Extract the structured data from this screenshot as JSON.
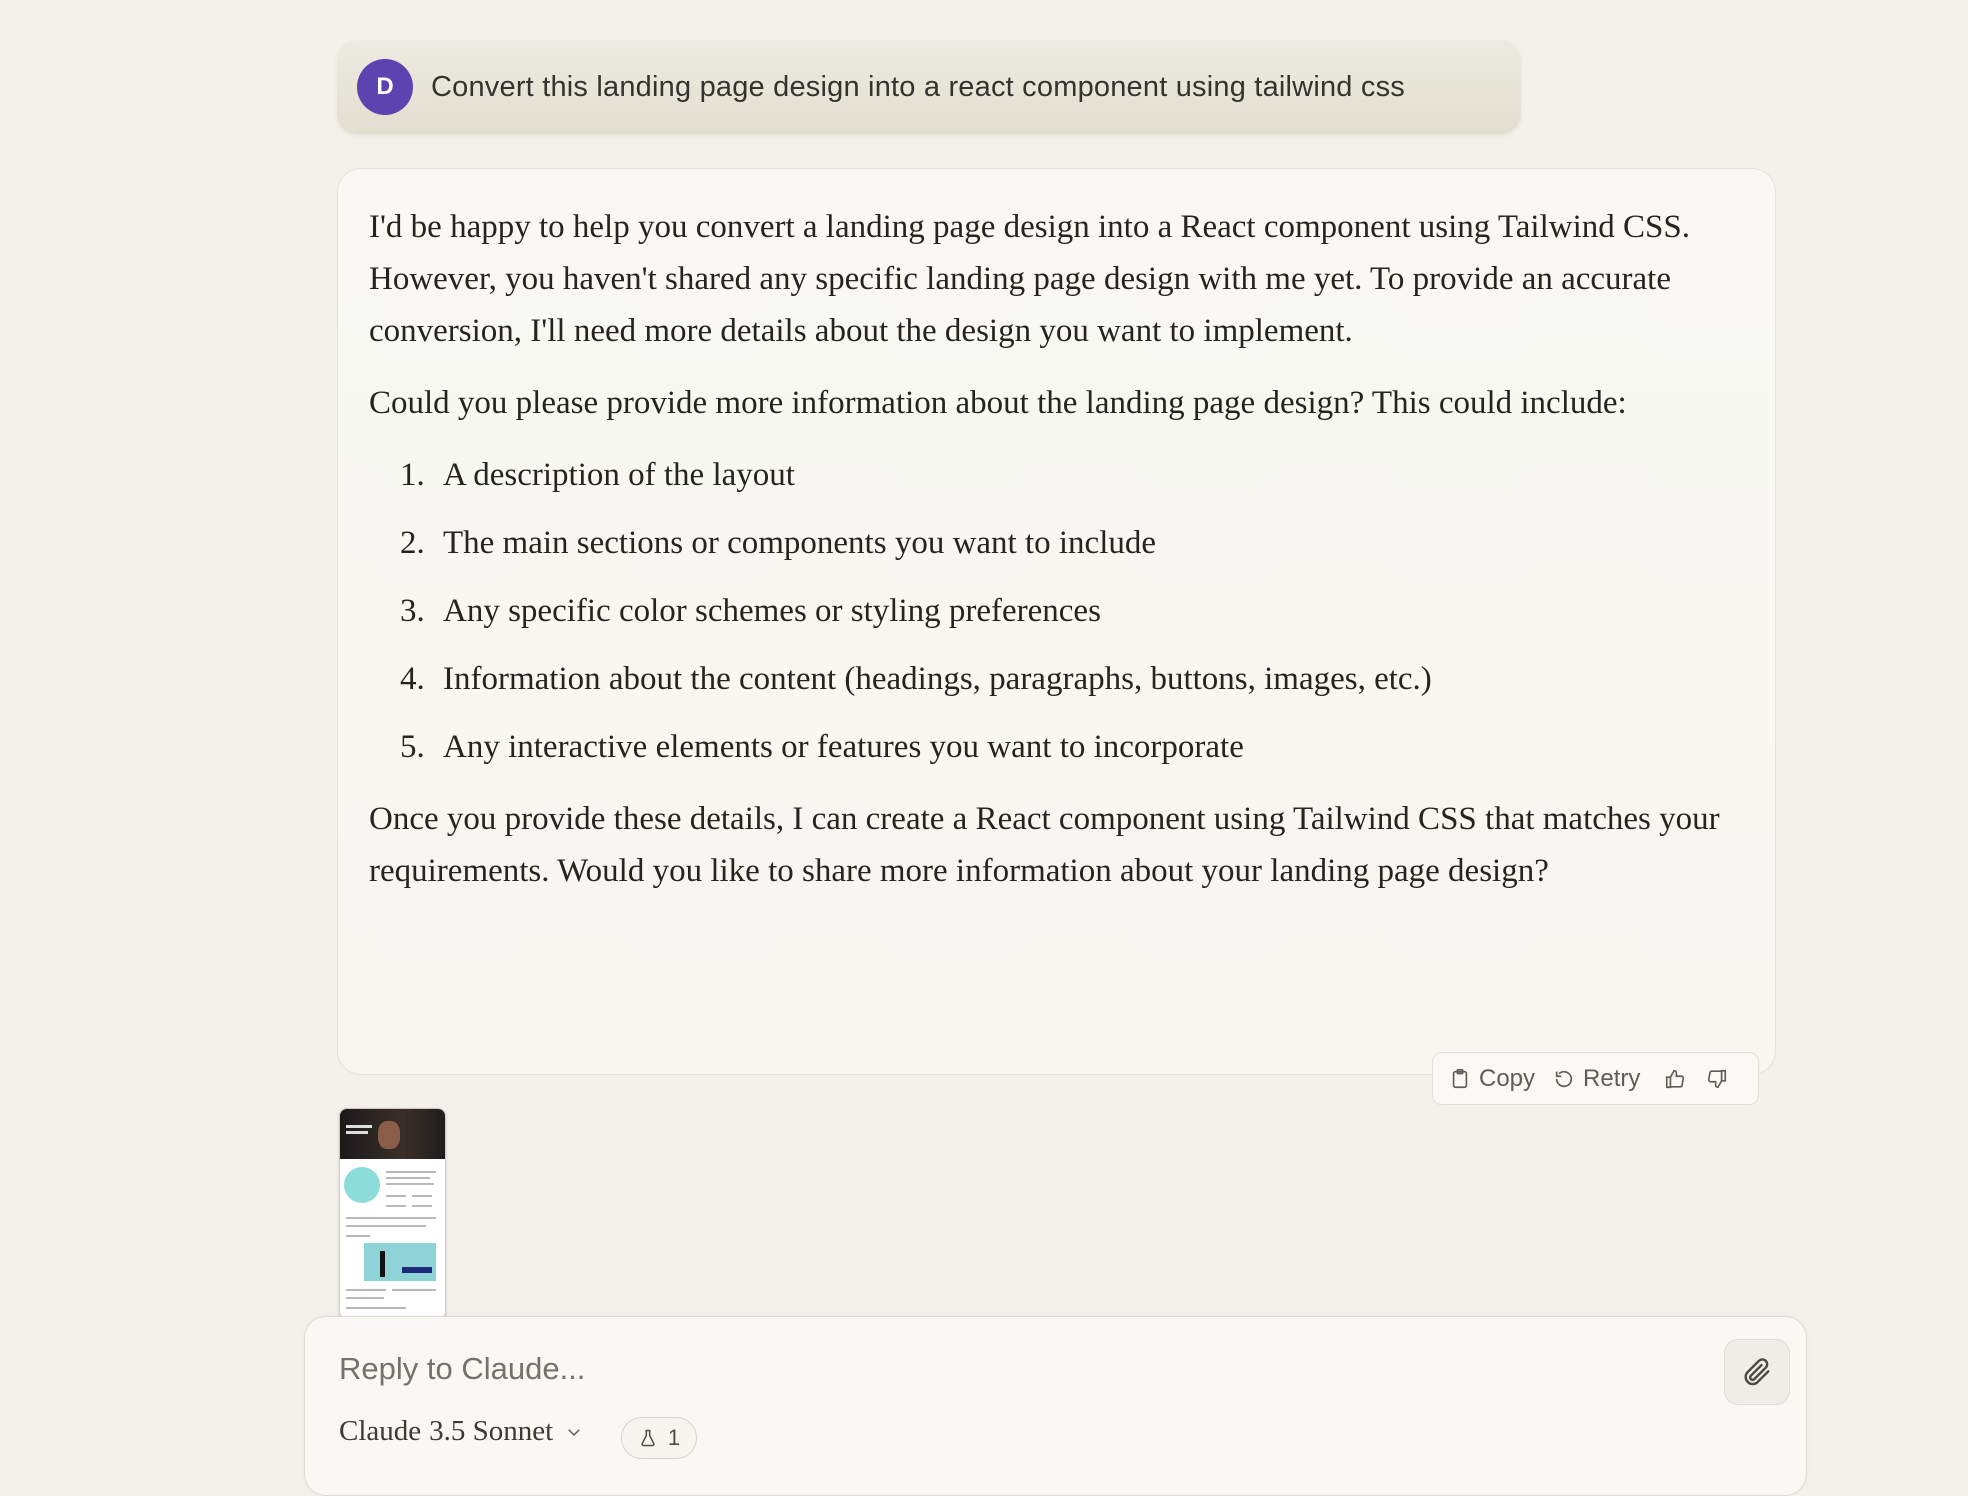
{
  "user_message": {
    "avatar_initial": "D",
    "text": "Convert this landing page design into a react component using tailwind css"
  },
  "assistant_message": {
    "paragraphs_before": [
      "I'd be happy to help you convert a landing page design into a React component using Tailwind CSS. However, you haven't shared any specific landing page design with me yet. To provide an accurate conversion, I'll need more details about the design you want to implement.",
      "Could you please provide more information about the landing page design? This could include:"
    ],
    "list_items": [
      "A description of the layout",
      "The main sections or components you want to include",
      "Any specific color schemes or styling preferences",
      "Information about the content (headings, paragraphs, buttons, images, etc.)",
      "Any interactive elements or features you want to incorporate"
    ],
    "paragraph_after": "Once you provide these details, I can create a React component using Tailwind CSS that matches your requirements. Would you like to share more information about your landing page design?"
  },
  "actions": {
    "copy_label": "Copy",
    "retry_label": "Retry",
    "icons": [
      "clipboard-icon",
      "retry-icon",
      "thumbs-up-icon",
      "thumbs-down-icon"
    ]
  },
  "attachment": {
    "type": "image-thumbnail"
  },
  "composer": {
    "placeholder": "Reply to Claude...",
    "model_name": "Claude",
    "model_version": "3.5 Sonnet",
    "experiment_count": "1"
  },
  "colors": {
    "background": "#f3f1ea",
    "avatar": "#5b43b0",
    "user_bubble": "#e7e4d8"
  }
}
